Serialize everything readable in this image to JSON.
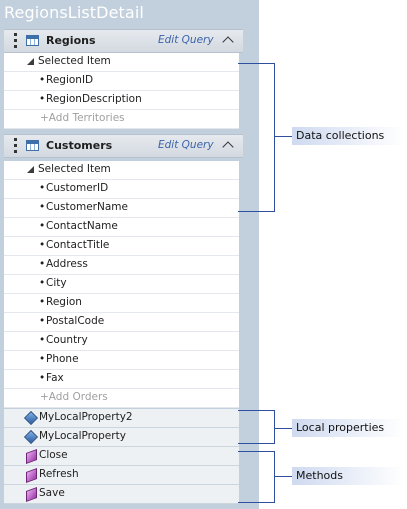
{
  "title": "RegionsListDetail",
  "groups": {
    "regions": {
      "label": "Regions",
      "edit_query": "Edit Query",
      "selected": "Selected Item",
      "fields": [
        "RegionID",
        "RegionDescription"
      ],
      "add": "+Add Territories"
    },
    "customers": {
      "label": "Customers",
      "edit_query": "Edit Query",
      "selected": "Selected Item",
      "fields": [
        "CustomerID",
        "CustomerName",
        "ContactName",
        "ContactTitle",
        "Address",
        "City",
        "Region",
        "PostalCode",
        "Country",
        "Phone",
        "Fax"
      ],
      "add": "+Add Orders"
    }
  },
  "properties": [
    "MyLocalProperty2",
    "MyLocalProperty"
  ],
  "methods": [
    "Close",
    "Refresh",
    "Save"
  ],
  "callouts": {
    "data": "Data collections",
    "local": "Local properties",
    "methods": "Methods"
  },
  "bullet": "•",
  "colors": {
    "panel": "#c2cfdc",
    "accent": "#3b63a8",
    "bracket": "#2f4ea0"
  }
}
